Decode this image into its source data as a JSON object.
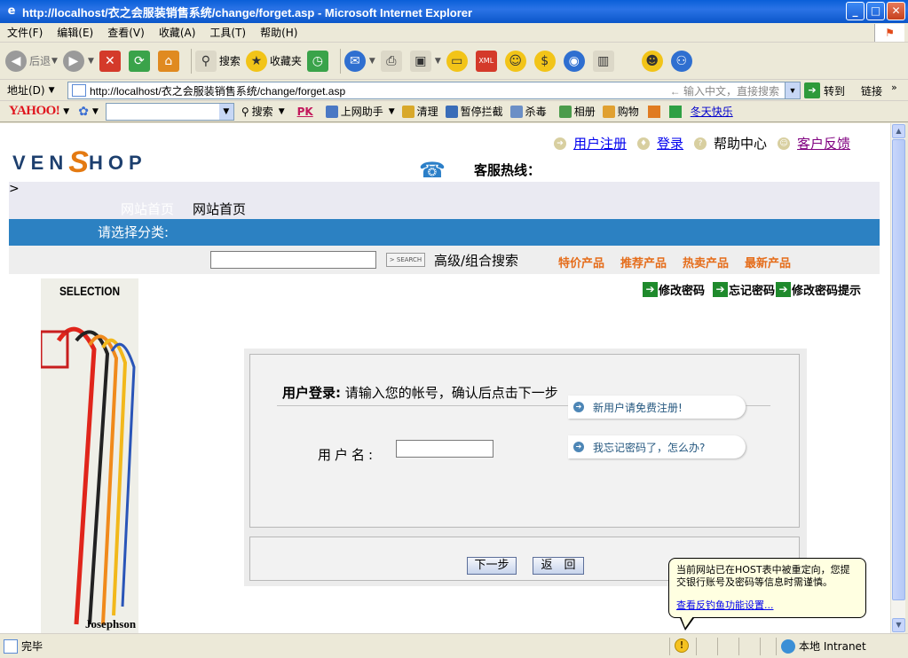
{
  "window": {
    "title": "http://localhost/衣之会服装销售系统/change/forget.asp - Microsoft Internet Explorer",
    "minimize": "_",
    "maximize": "□",
    "close": "✕"
  },
  "menu": [
    "文件(F)",
    "编辑(E)",
    "查看(V)",
    "收藏(A)",
    "工具(T)",
    "帮助(H)"
  ],
  "toolbar": {
    "back": "后退",
    "search": "搜索",
    "favorites": "收藏夹"
  },
  "address": {
    "label": "地址(D)",
    "url": "http://localhost/衣之会服装销售系统/change/forget.asp",
    "hint": "输入中文，直接搜索",
    "go": "转到",
    "links": "链接"
  },
  "yahoo_bar": {
    "logo": "YAHOO!",
    "search": "搜索",
    "pk": "PK",
    "items": [
      "上网助手",
      "清理",
      "暂停拦截",
      "杀毒",
      "相册",
      "购物"
    ],
    "link": "冬天快乐"
  },
  "site": {
    "logo_left": "VEN",
    "logo_s": "S",
    "logo_right": "HOP",
    "top_links": {
      "register": "用户注册",
      "login": "登录",
      "help": "帮助中心",
      "feedback": "客户反馈"
    },
    "hotline": "客服热线：",
    "breadcrumb_home_a": "网站首页",
    "breadcrumb_home_b": "网站首页",
    "category_prompt": "请选择分类:",
    "search_button": "> SEARCH",
    "advanced_search": "高级/组合搜索",
    "categories": [
      "特价产品",
      "推荐产品",
      "热卖产品",
      "最新产品"
    ],
    "banner_title": "SELECTION",
    "banner_brand": "Josephson",
    "pwd_links": [
      "修改密码",
      "忘记密码",
      "修改密码提示"
    ],
    "login": {
      "heading_bold": "用户登录:",
      "heading_text": " 请输入您的帐号，确认后点击下一步",
      "username_label": "用户名:",
      "register_link": "新用户请免费注册!",
      "forgot_link": "我忘记密码了，怎么办?",
      "next_button": "下一步",
      "back_button": "返　回"
    }
  },
  "balloon": {
    "text": "当前网站已在HOST表中被重定向，您提交银行账号及密码等信息时需谨慎。",
    "link": "查看反钓鱼功能设置..."
  },
  "status": {
    "text": "完毕",
    "zone": "本地 Intranet"
  }
}
